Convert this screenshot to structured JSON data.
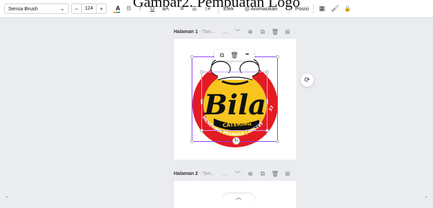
{
  "overlay_caption": "Gambar2. Pembuatan Logo",
  "toolbar": {
    "font_name": "Sensa Brush",
    "font_dropdown_icon": "chevron-down-icon",
    "size_decrease": "−",
    "font_size": "124",
    "size_increase": "+",
    "text_color_glyph": "A",
    "bold_glyph": "B",
    "italic_glyph": "I",
    "underline_glyph": "U",
    "case_glyph": "aA",
    "align_glyph": "≡",
    "list_glyph": "☰",
    "spacing_glyph": "↕≡",
    "effects_label": "Efek",
    "animate_label": "Animasikan",
    "position_label": "Posisi",
    "transparency_glyph": "▦",
    "paint_format_glyph": "🖌",
    "lock_glyph": "🔒"
  },
  "pages": [
    {
      "label": "Halaman 1",
      "subtitle": "- Tam...",
      "icons": [
        "chevron-up-icon",
        "chevron-down-icon",
        "lock-icon",
        "duplicate-icon",
        "trash-icon",
        "add-page-icon"
      ]
    },
    {
      "label": "Halaman 2",
      "subtitle": "- Tam...",
      "icons": [
        "chevron-up-icon",
        "chevron-down-icon",
        "lock-icon",
        "duplicate-icon",
        "trash-icon",
        "add-page-icon"
      ]
    }
  ],
  "icon_glyphs": {
    "chevron_up": "︿",
    "chevron_down": "﹀",
    "lock": "⊕",
    "duplicate": "⧉",
    "trash": "🗑",
    "add_page": "⊞"
  },
  "floating_menu": {
    "copy_glyph": "⧉",
    "delete_glyph": "🗑",
    "more_glyph": "•••"
  },
  "logo": {
    "brand": "Bila",
    "ribbon": "CATERING",
    "arc_text": "MENERIMA PESANAN | 085285",
    "arc_text_right": "37",
    "colors": {
      "red": "#e31b23",
      "yellow": "#f7c51e",
      "black": "#111111",
      "white": "#ffffff"
    }
  },
  "rotate_glyph": "↻",
  "refresh_glyph": "⟳",
  "collapse_glyph": "︿",
  "accent_color": "#8b3dff"
}
